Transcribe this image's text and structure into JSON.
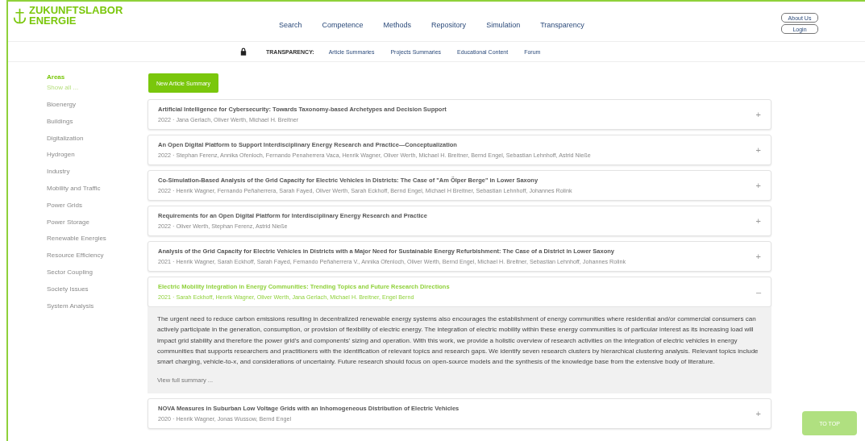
{
  "logo": {
    "lines": [
      "ZUKUNFTSLABOR",
      "ENERGIE"
    ]
  },
  "nav": [
    {
      "label": "Search"
    },
    {
      "label": "Competence"
    },
    {
      "label": "Methods"
    },
    {
      "label": "Repository"
    },
    {
      "label": "Simulation"
    },
    {
      "label": "Transparency"
    }
  ],
  "account_buttons": [
    "About Us",
    "Login"
  ],
  "subnav": {
    "heading": "TRANSPARENCY:",
    "links": [
      "Article Summaries",
      "Projects Summaries",
      "Educational Content",
      "Forum"
    ]
  },
  "sidebar": {
    "heading": "Areas",
    "show_all": "Show all ...",
    "items": [
      "Bioenergy",
      "Buildings",
      "Digitalization",
      "Hydrogen",
      "Industry",
      "Mobility and Traffic",
      "Power Grids",
      "Power Storage",
      "Renewable Energies",
      "Resource Efficiency",
      "Sector Coupling",
      "Society Issues",
      "System Analysis"
    ]
  },
  "new_button": "New Article Summary",
  "articles": [
    {
      "title": "Artificial Intelligence for Cybersecurity: Towards Taxonomy-based Archetypes and Decision Support",
      "meta": "2022 · Jana Gerlach, Oliver Werth, Michael H. Breitner",
      "toggle": "+",
      "expanded": false
    },
    {
      "title": "An Open Digital Platform to Support Interdisciplinary Energy Research and Practice—Conceptualization",
      "meta": "2022 · Stephan Ferenz, Annika Ofenloch, Fernando Penaherrera Vaca, Henrik Wagner, Oliver Werth, Michael H. Breitner, Bernd Engel, Sebastian Lehnhoff, Astrid Nieße",
      "toggle": "+",
      "expanded": false
    },
    {
      "title": "Co-Simulation-Based Analysis of the Grid Capacity for Electric Vehicles in Districts: The Case of \"Am Ölper Berge\" in Lower Saxony",
      "meta": "2022 · Henrik Wagner, Fernando Peñaherrera, Sarah Fayed, Oliver Werth, Sarah Eckhoff, Bernd Engel, Michael H Breitner, Sebastian Lehnhoff, Johannes Rolink",
      "toggle": "+",
      "expanded": false
    },
    {
      "title": "Requirements for an Open Digital Platform for Interdisciplinary Energy Research and Practice",
      "meta": "2022 · Oliver Werth, Stephan Ferenz, Astrid Nieße",
      "toggle": "+",
      "expanded": false
    },
    {
      "title": "Analysis of the Grid Capacity for Electric Vehicles in Districts with a Major Need for Sustainable Energy Refurbishment: The Case of a District in Lower Saxony",
      "meta": "2021 · Henrik Wagner, Sarah Eckhoff, Sarah Fayed, Fernando Peñaherrera V., Annika Ofenloch, Oliver Werth, Bernd Engel, Michael H. Breitner, Sebastian Lehnhoff, Johannes Rolink",
      "toggle": "+",
      "expanded": false
    },
    {
      "title": "Electric Mobility Integration in Energy Communities: Trending Topics and Future Research Directions",
      "meta": "2021 · Sarah Eckhoff, Henrik Wagner, Oliver Werth, Jana Gerlach, Michael H. Breitner, Engel Bernd",
      "toggle": "–",
      "expanded": true,
      "summary": "The urgent need to reduce carbon emissions resulting in decentralized renewable energy systems also encourages the establishment of energy communities where residential and/or commercial consumers can actively participate in the generation, consumption, or provision of flexibility of electric energy. The integration of electric mobility within these energy communities is of particular interest as its increasing load will impact grid stability and therefore the power grid's and components' sizing and operation. With this work, we provide a holistic overview of research activities on the integration of electric vehicles in energy communities that supports researchers and practitioners with the identification of relevant topics and research gaps. We identify seven research clusters by hierarchical clustering analysis. Relevant topics include smart charging, vehicle-to-x, and considerations of uncertainty. Future research should focus on open-source models and the synthesis of the knowledge base from the extensive body of literature.",
      "more": "View full summary ..."
    },
    {
      "title": "NOVA Measures in Suburban Low Voltage Grids with an Inhomogeneous Distribution of Electric Vehicles",
      "meta": "2020 · Henrik Wagner, Jonas Wussow, Bernd Engel",
      "toggle": "+",
      "expanded": false
    }
  ],
  "to_top": "TO TOP"
}
